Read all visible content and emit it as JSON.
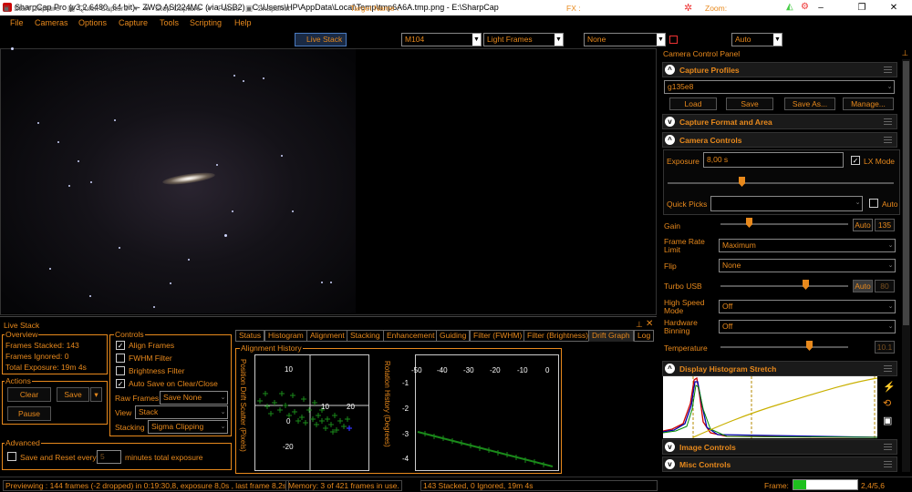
{
  "titlebar": {
    "title": "SharpCap Pro (v3.2.6480, 64 bit) - ZWO ASI224MC (via USB2) - C:\\Users\\HP\\AppData\\Local\\Temp\\tmp6A6A.tmp.png - E:\\SharpCap",
    "minimize": "–",
    "maximize": "❐",
    "close": "✕"
  },
  "menu": [
    "File",
    "Cameras",
    "Options",
    "Capture",
    "Tools",
    "Scripting",
    "Help"
  ],
  "toolbar": {
    "start_capture": "Start Capture",
    "quick_capture": "Quick Capture",
    "stop_capture": "Stop Capture",
    "pause": "Pause",
    "snapshot": "Snapshot",
    "live_stack": "Live Stack",
    "target_label": "Target Name :",
    "target_value": "M104",
    "frame_type": "Light Frames",
    "fx_label": "FX :",
    "fx_value": "None",
    "zoom_label": "Zoom:",
    "zoom_value": "Auto"
  },
  "ccp": {
    "title": "Camera Control Panel",
    "pin": "📌",
    "sections": {
      "profiles": "Capture Profiles",
      "format": "Capture Format and Area",
      "controls": "Camera Controls",
      "histogram": "Display Histogram Stretch",
      "image": "Image Controls",
      "misc": "Misc Controls"
    },
    "profile": "g135e8",
    "load": "Load",
    "save": "Save",
    "save_as": "Save As...",
    "manage": "Manage...",
    "exposure_label": "Exposure",
    "exposure_value": "8,00 s",
    "lx_mode": "LX Mode",
    "quick_picks": "Quick Picks",
    "auto": "Auto",
    "gain_label": "Gain",
    "gain_auto": "Auto",
    "gain_value": "135",
    "frame_rate_label": "Frame Rate Limit",
    "frame_rate_value": "Maximum",
    "flip_label": "Flip",
    "flip_value": "None",
    "turbo_label": "Turbo USB",
    "turbo_auto": "Auto",
    "turbo_value": "80",
    "hispeed_label": "High Speed Mode",
    "hispeed_value": "Off",
    "binning_label": "Hardware Binning",
    "binning_value": "Off",
    "temp_label": "Temperature",
    "temp_value": "10.1"
  },
  "livestack": {
    "title": "Live Stack",
    "overview": "Overview",
    "frames_stacked": "Frames Stacked: 143",
    "frames_ignored": "Frames Ignored:  0",
    "total_exposure": "Total Exposure:  19m 4s",
    "actions": "Actions",
    "clear": "Clear",
    "save": "Save",
    "pause": "Pause",
    "controls": "Controls",
    "align": "Align Frames",
    "fwhm": "FWHM Filter",
    "brightness": "Brightness Filter",
    "autosave": "Auto Save on Clear/Close",
    "raw_frames_label": "Raw Frames",
    "raw_frames_value": "Save None",
    "view_label": "View",
    "view_value": "Stack",
    "stacking_label": "Stacking",
    "stacking_value": "Sigma Clipping",
    "advanced": "Advanced",
    "save_reset": "Save and Reset every",
    "minutes_value": "5",
    "minutes_label": "minutes total exposure",
    "tabs": [
      "Status",
      "Histogram",
      "Alignment",
      "Stacking",
      "Enhancement",
      "Guiding",
      "Filter (FWHM)",
      "Filter (Brightness)",
      "Drift Graph",
      "Log"
    ],
    "align_history": "Alignment History",
    "pos_drift": "Position Drift Scatter (Pixels)",
    "rot_history": "Rotation History (Degrees)",
    "scatter_ticks_y": [
      "10",
      "0",
      "-20"
    ],
    "scatter_ticks_x": [
      "10",
      "20"
    ],
    "rot_ticks_x": [
      "-50",
      "-40",
      "-30",
      "-20",
      "-10",
      "0"
    ],
    "rot_ticks_y": [
      "-1",
      "-2",
      "-3",
      "-4"
    ]
  },
  "status": {
    "preview": "Previewing : 144 frames (-2 dropped) in 0:19:30,8, exposure 8,0s , last frame 8,2s",
    "memory": "Memory: 3 of 421 frames in use.",
    "stacked": "143 Stacked, 0 Ignored, 19m 4s",
    "frame_label": "Frame:",
    "fps": "2,4/5,6"
  }
}
